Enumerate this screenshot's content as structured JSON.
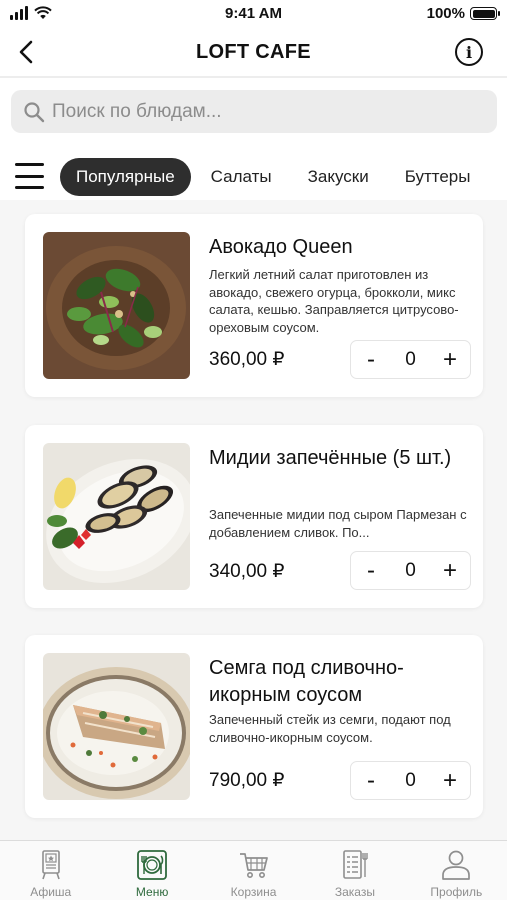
{
  "status_bar": {
    "time": "9:41 AM",
    "battery": "100%",
    "battery_level": 1.0
  },
  "header": {
    "title": "LOFT CAFE"
  },
  "search": {
    "placeholder": "Поиск по блюдам..."
  },
  "categories": [
    {
      "label": "Популярные",
      "active": true
    },
    {
      "label": "Салаты",
      "active": false
    },
    {
      "label": "Закуски",
      "active": false
    },
    {
      "label": "Буттеры",
      "active": false
    }
  ],
  "dishes": [
    {
      "title": "Авокадо Queen",
      "description": "Легкий летний салат приготовлен из авокадо, свежего огурца, брокколи, микс салата, кешью. Заправляется цитрусово-ореховым соусом.",
      "price": "360,00 ₽",
      "quantity": "0"
    },
    {
      "title": "Мидии запечённые (5 шт.)",
      "description": "Запеченные мидии под сыром Пармезан с добавлением сливок. По...",
      "price": "340,00 ₽",
      "quantity": "0"
    },
    {
      "title": "Семга под сливочно-икорным соусом",
      "description": "Запеченный стейк из семги, подают под сливочно-икорным соусом.",
      "price": "790,00 ₽",
      "quantity": "0"
    }
  ],
  "stepper": {
    "minus": "-",
    "plus": "+"
  },
  "tabbar": [
    {
      "label": "Афиша",
      "icon": "poster-icon",
      "active": false
    },
    {
      "label": "Меню",
      "icon": "plate-cutlery-icon",
      "active": true
    },
    {
      "label": "Корзина",
      "icon": "cart-icon",
      "active": false
    },
    {
      "label": "Заказы",
      "icon": "orders-icon",
      "active": false
    },
    {
      "label": "Профиль",
      "icon": "profile-icon",
      "active": false
    }
  ],
  "colors": {
    "accent": "#2f6a3d",
    "active_chip": "#2e2e2e",
    "tab_inactive": "#8e8e8e"
  }
}
